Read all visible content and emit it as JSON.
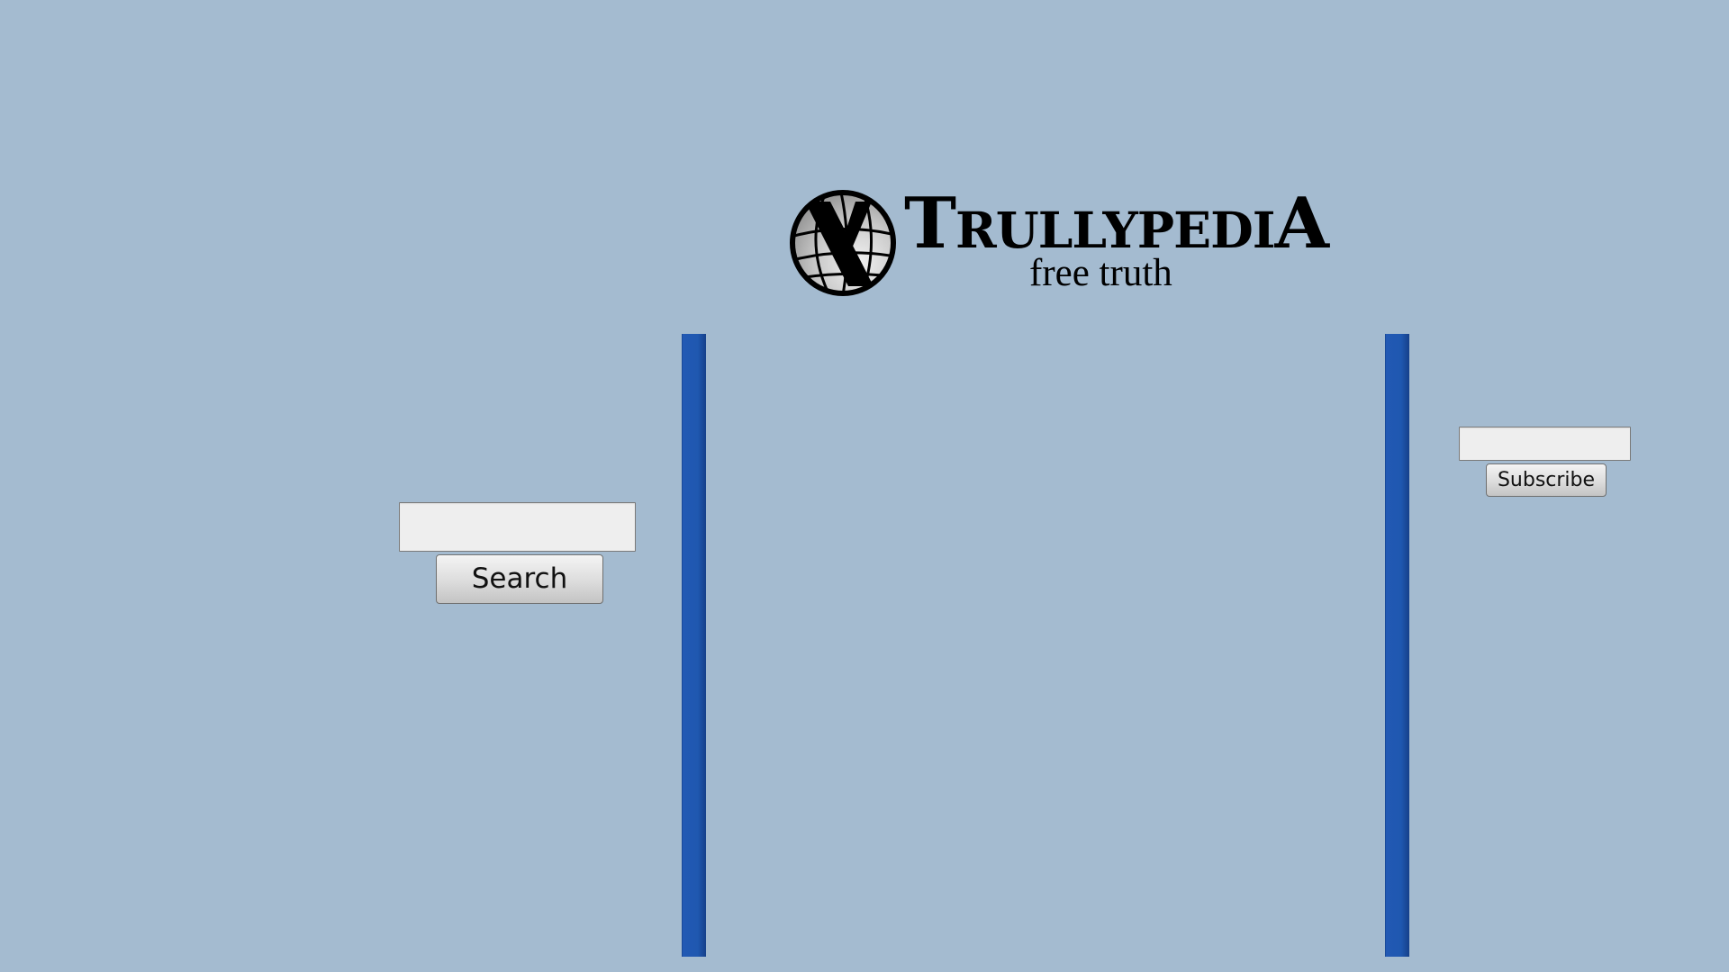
{
  "header": {
    "brand_first_letter": "T",
    "brand_middle": "RULLYPEDI",
    "brand_last_letter": "A",
    "tagline": "free truth",
    "logo_icon": "globe-logo-icon"
  },
  "search": {
    "input_value": "",
    "placeholder": "",
    "button_label": "Search"
  },
  "subscribe": {
    "input_value": "",
    "placeholder": "",
    "button_label": "Subscribe"
  },
  "colors": {
    "background": "#a4bbd0",
    "divider": "#2259b4",
    "input_background": "#eeeeee"
  }
}
